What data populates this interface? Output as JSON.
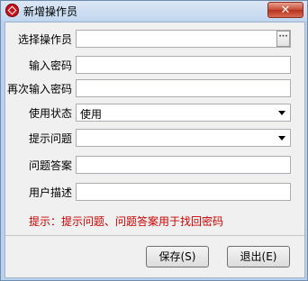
{
  "window": {
    "title": "新增操作员",
    "close_label": "✕"
  },
  "form": {
    "operator": {
      "label": "选择操作员",
      "value": "",
      "browse_label": "···"
    },
    "password": {
      "label": "输入密码",
      "value": ""
    },
    "password_confirm": {
      "label": "再次输入密码",
      "value": ""
    },
    "status": {
      "label": "使用状态",
      "value": "使用"
    },
    "question": {
      "label": "提示问题",
      "value": ""
    },
    "answer": {
      "label": "问题答案",
      "value": ""
    },
    "description": {
      "label": "用户描述",
      "value": ""
    }
  },
  "hint": "提示：提示问题、问题答案用于找回密码",
  "buttons": {
    "save": "保存(S)",
    "exit": "退出(E)"
  },
  "colors": {
    "hint": "#cc0000",
    "titlebar": "#c2d7ef",
    "close": "#c74a33"
  }
}
